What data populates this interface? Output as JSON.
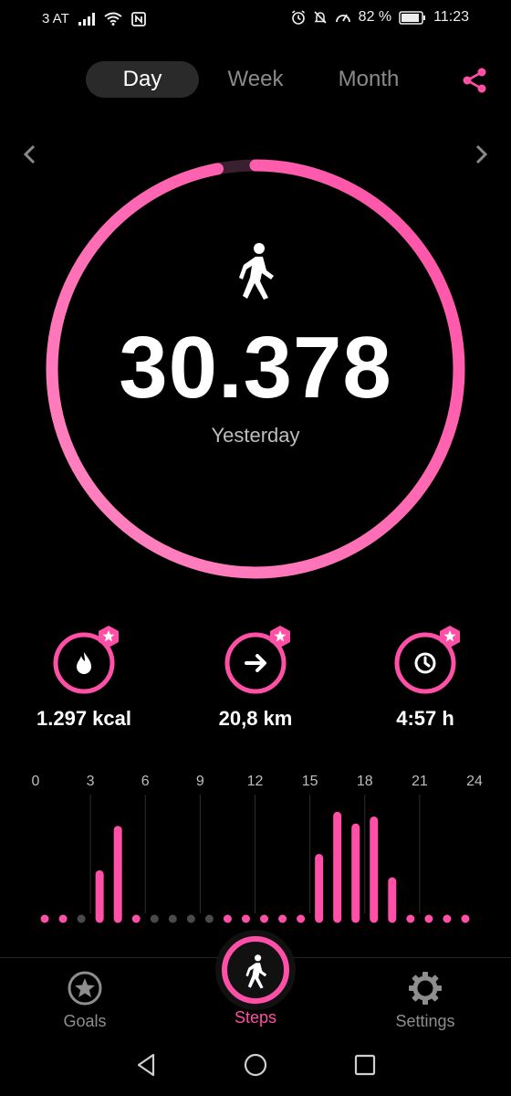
{
  "status_bar": {
    "carrier": "3 AT",
    "battery": "82 %",
    "time": "11:23"
  },
  "tabs": [
    {
      "label": "Day",
      "active": true
    },
    {
      "label": "Week",
      "active": false
    },
    {
      "label": "Month",
      "active": false
    }
  ],
  "summary": {
    "steps": "30.378",
    "day_label": "Yesterday",
    "progress": 0.97
  },
  "stats": {
    "calories": "1.297 kcal",
    "distance": "20,8 km",
    "duration": "4:57 h"
  },
  "chart_data": {
    "type": "bar",
    "x_ticks": [
      "0",
      "3",
      "6",
      "9",
      "12",
      "15",
      "18",
      "21",
      "24"
    ],
    "x": [
      0,
      1,
      2,
      3,
      4,
      5,
      6,
      7,
      8,
      9,
      10,
      11,
      12,
      13,
      14,
      15,
      16,
      17,
      18,
      19,
      20,
      21,
      22,
      23
    ],
    "values": [
      0,
      0,
      0,
      0.19,
      0.38,
      0,
      0,
      0,
      0,
      0,
      0,
      0,
      0,
      0,
      0,
      0.26,
      0.44,
      0.39,
      0.42,
      0.16,
      0,
      0,
      0,
      0
    ],
    "ylim": [
      0,
      0.5
    ],
    "colors": {
      "active": "#ff4fa6",
      "inactive": "#4a4a4a"
    },
    "active_dots": [
      0,
      1,
      5,
      10,
      11,
      12,
      13,
      14,
      15,
      16,
      17,
      18,
      19,
      20,
      21,
      22,
      23
    ]
  },
  "nav": {
    "goals": "Goals",
    "steps": "Steps",
    "settings": "Settings"
  },
  "colors": {
    "accent": "#ff4fa6",
    "accent_light": "#ff87c2",
    "background": "#000000"
  }
}
